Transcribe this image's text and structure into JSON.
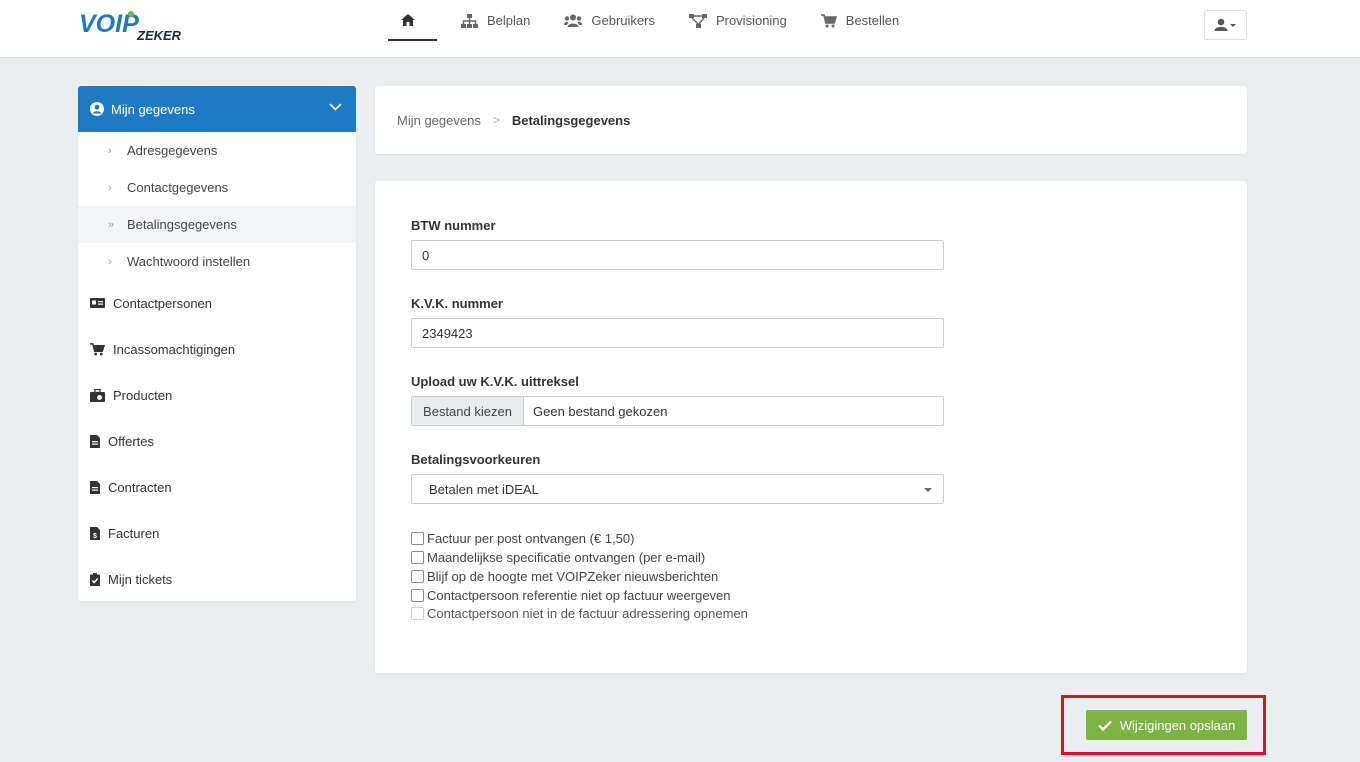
{
  "brand": {
    "logo_text_main": "VOIP",
    "logo_text_sub": "ZEKER",
    "colors": {
      "primary": "#1f7ac4",
      "success": "#7cb342",
      "highlight": "#e0102f"
    }
  },
  "nav": {
    "home_icon": "home-icon",
    "items": [
      {
        "label": "Belplan",
        "icon": "sitemap-icon"
      },
      {
        "label": "Gebruikers",
        "icon": "users-icon"
      },
      {
        "label": "Provisioning",
        "icon": "network-icon"
      },
      {
        "label": "Bestellen",
        "icon": "cart-icon"
      }
    ],
    "user_menu_icon": "user-caret-icon"
  },
  "sidebar": {
    "header": {
      "label": "Mijn gegevens",
      "icon": "user-circle-icon"
    },
    "sub_items": [
      {
        "label": "Adresgegevens"
      },
      {
        "label": "Contactgegevens"
      },
      {
        "label": "Betalingsgegevens",
        "active": true
      },
      {
        "label": "Wachtwoord instellen"
      }
    ],
    "items": [
      {
        "label": "Contactpersonen",
        "icon": "id-card-icon"
      },
      {
        "label": "Incassomachtigingen",
        "icon": "cart-icon"
      },
      {
        "label": "Producten",
        "icon": "briefcase-icon"
      },
      {
        "label": "Offertes",
        "icon": "file-icon"
      },
      {
        "label": "Contracten",
        "icon": "file-icon"
      },
      {
        "label": "Facturen",
        "icon": "invoice-icon"
      },
      {
        "label": "Mijn tickets",
        "icon": "clipboard-check-icon"
      }
    ]
  },
  "breadcrumb": {
    "parent": "Mijn gegevens",
    "current": "Betalingsgegevens"
  },
  "form": {
    "btw_label": "BTW nummer",
    "btw_value": "0",
    "kvk_label": "K.V.K. nummer",
    "kvk_value": "2349423",
    "upload_label": "Upload uw K.V.K. uittreksel",
    "upload_button": "Bestand kiezen",
    "upload_status": "Geen bestand gekozen",
    "pref_label": "Betalingsvoorkeuren",
    "pref_value": "Betalen met iDEAL",
    "checkboxes": [
      {
        "label": "Factuur per post ontvangen (€ 1,50)",
        "checked": false
      },
      {
        "label": "Maandelijkse specificatie ontvangen (per e-mail)",
        "checked": false
      },
      {
        "label": "Blijf op de hoogte met VOIPZeker nieuwsberichten",
        "checked": false
      },
      {
        "label": "Contactpersoon referentie niet op factuur weergeven",
        "checked": false
      },
      {
        "label": "Contactpersoon niet in de factuur adressering opnemen",
        "checked": false,
        "disabled": true
      }
    ]
  },
  "save_button": {
    "label": "Wijzigingen opslaan",
    "icon": "check-icon"
  }
}
